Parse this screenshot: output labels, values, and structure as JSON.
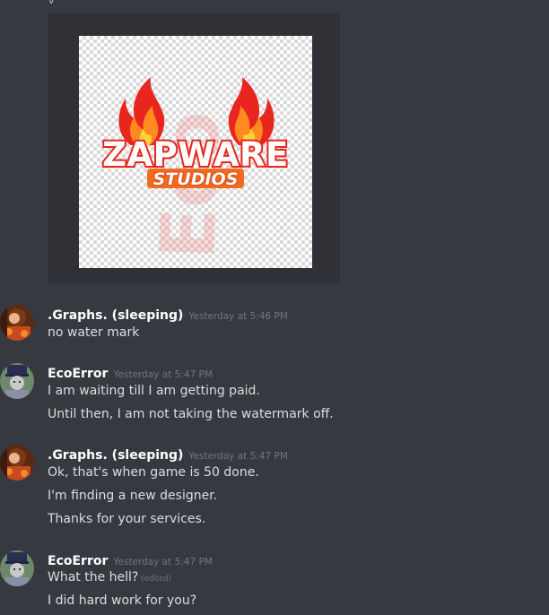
{
  "attachment": {
    "logo_title": "ZAPWARE",
    "logo_subtitle": "STUDIOS",
    "watermark_text": "Eco"
  },
  "messages": [
    {
      "username": ".Graphs. (sleeping)",
      "timestamp": "Yesterday at 5:46 PM",
      "lines": [
        "no water mark"
      ]
    },
    {
      "username": "EcoError",
      "timestamp": "Yesterday at 5:47 PM",
      "lines": [
        "I am waiting till I am getting paid.",
        "Until then, I am not taking the watermark off."
      ]
    },
    {
      "username": ".Graphs. (sleeping)",
      "timestamp": "Yesterday at 5:47 PM",
      "lines": [
        "Ok, that's when game is 50 done.",
        "I'm finding a new designer.",
        "Thanks for your services."
      ]
    },
    {
      "username": "EcoError",
      "timestamp": "Yesterday at 5:47 PM",
      "lines": [
        "What the hell?",
        "I did hard work for you?"
      ],
      "edited_label": "(edited)"
    }
  ],
  "colors": {
    "background": "#36393f",
    "attachment_bg": "#2f3136",
    "username": "#ffffff",
    "timestamp": "#72767d",
    "message_text": "#dcddde",
    "watermark": "#f08080"
  },
  "icons": {
    "graphs_avatar": "roblox-character-avatar-icon",
    "ecoerror_avatar": "roblox-character-avatar-icon",
    "flame": "flame-icon"
  }
}
